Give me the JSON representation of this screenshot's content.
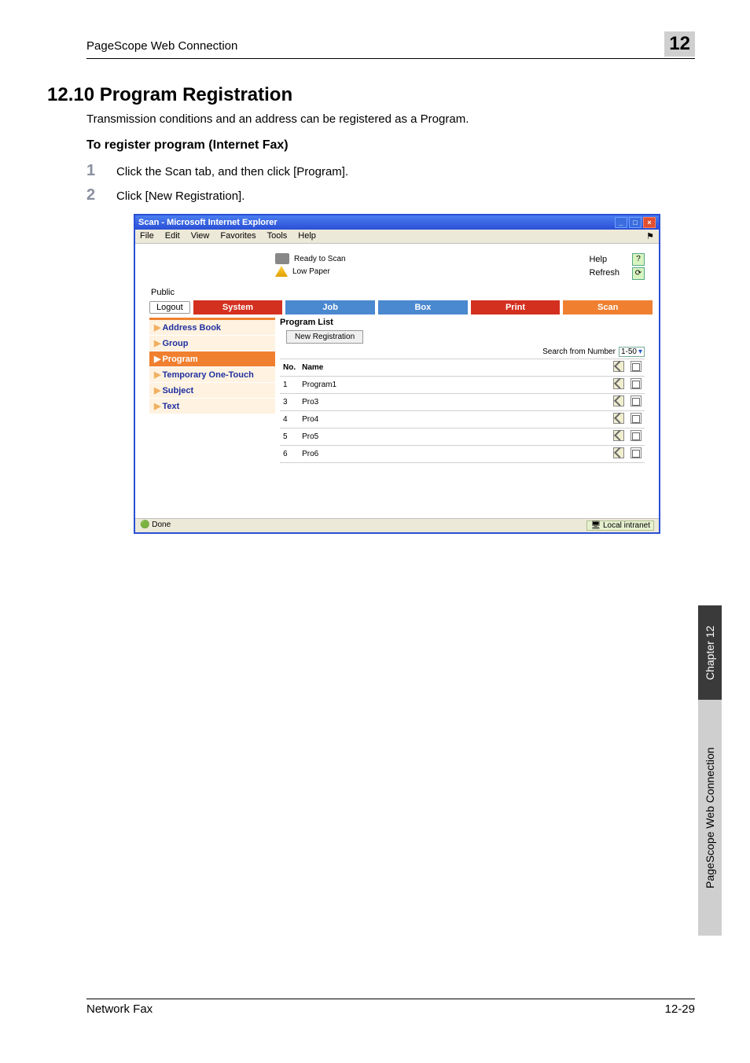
{
  "header": {
    "left": "PageScope Web Connection",
    "right": "12"
  },
  "section": {
    "title": "12.10  Program Registration"
  },
  "intro": "Transmission conditions and an address can be registered as a Program.",
  "subheading": "To register program (Internet Fax)",
  "steps": [
    {
      "num": "1",
      "text": "Click the Scan tab, and then click [Program]."
    },
    {
      "num": "2",
      "text": "Click [New Registration]."
    }
  ],
  "browser": {
    "title": "Scan - Microsoft Internet Explorer",
    "menus": [
      "File",
      "Edit",
      "View",
      "Favorites",
      "Tools",
      "Help"
    ],
    "status": {
      "ready": "Ready to Scan",
      "paper": "Low Paper",
      "help": "Help",
      "refresh": "Refresh"
    },
    "public": "Public",
    "logout": "Logout",
    "tabs": {
      "system": "System",
      "job": "Job",
      "box": "Box",
      "print": "Print",
      "scan": "Scan"
    },
    "sidebar": {
      "addressbook": "Address Book",
      "group": "Group",
      "program": "Program",
      "temp": "Temporary One-Touch",
      "subject": "Subject",
      "text": "Text"
    },
    "panel": {
      "title": "Program List",
      "newreg": "New Registration",
      "searchlabel": "Search from Number",
      "searchsel": "1-50"
    },
    "table": {
      "hdr_no": "No.",
      "hdr_name": "Name",
      "rows": [
        {
          "no": "1",
          "name": "Program1"
        },
        {
          "no": "3",
          "name": "Pro3"
        },
        {
          "no": "4",
          "name": "Pro4"
        },
        {
          "no": "5",
          "name": "Pro5"
        },
        {
          "no": "6",
          "name": "Pro6"
        }
      ]
    },
    "done": "Done",
    "zone": "Local intranet"
  },
  "sidetab": {
    "dark": "Chapter 12",
    "light": "PageScope Web Connection"
  },
  "footer": {
    "left": "Network Fax",
    "right": "12-29"
  }
}
